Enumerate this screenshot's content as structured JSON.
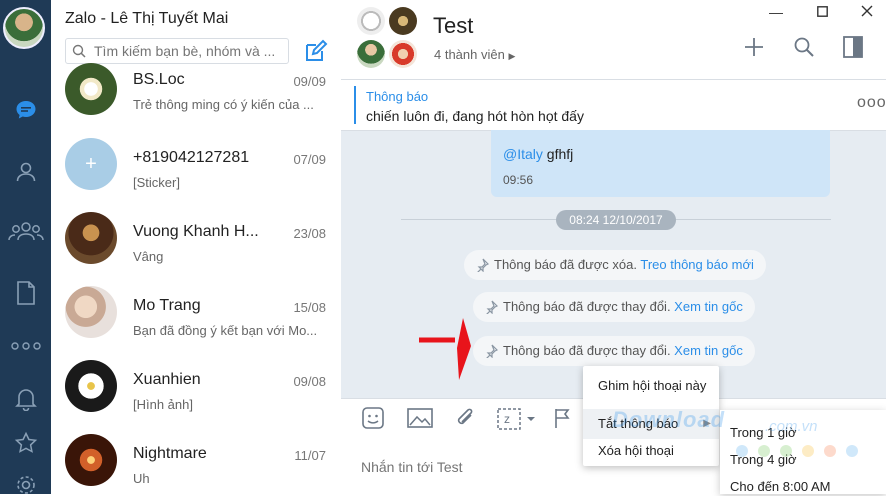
{
  "app": {
    "title": "Zalo - Lê Thị Tuyết Mai"
  },
  "search": {
    "placeholder": "Tìm kiếm bạn bè, nhóm và ..."
  },
  "conversations": [
    {
      "name": "BS.Loc",
      "date": "09/09",
      "preview": "Trẻ thông ming có ý kiến của ..."
    },
    {
      "name": "+819042127281",
      "date": "07/09",
      "preview": "[Sticker]"
    },
    {
      "name": "Vuong Khanh H...",
      "date": "23/08",
      "preview": "Vâng"
    },
    {
      "name": "Mo Trang",
      "date": "15/08",
      "preview": "Bạn đã đồng ý kết bạn với Mo..."
    },
    {
      "name": "Xuanhien",
      "date": "09/08",
      "preview": "[Hình ảnh]"
    },
    {
      "name": "Nightmare",
      "date": "11/07",
      "preview": "Uh"
    }
  ],
  "chat": {
    "title": "Test",
    "members": "4 thành viên",
    "pinned": {
      "heading": "Thông báo",
      "text": "chiến luôn đi, đang hót hòn họt đấy"
    },
    "message": {
      "mention": "@Italy",
      "text": " gfhfj",
      "time": "09:56"
    },
    "date_separator": "08:24 12/10/2017",
    "system_messages": [
      {
        "text": "Thông báo đã được xóa. ",
        "link": "Treo thông báo mới"
      },
      {
        "text": "Thông báo đã được thay đổi. ",
        "link": "Xem tin gốc"
      },
      {
        "text": "Thông báo đã được thay đổi. ",
        "link": "Xem tin gốc"
      }
    ],
    "input_placeholder": "Nhắn tin tới Test"
  },
  "context_menu": {
    "items": [
      "Ghim hội thoại này",
      "Tắt thông báo",
      "Xóa hội thoại"
    ]
  },
  "submenu": {
    "items": [
      "Trong 1 giờ",
      "Trong 4 giờ",
      "Cho đến 8:00 AM"
    ]
  },
  "watermark": {
    "text": "Download",
    "suffix": ".com.vn"
  },
  "colors": {
    "rail": "#1f3a56",
    "accent": "#2b8ee8",
    "bubble": "#cfe5f8",
    "arrow": "#e8141b"
  }
}
